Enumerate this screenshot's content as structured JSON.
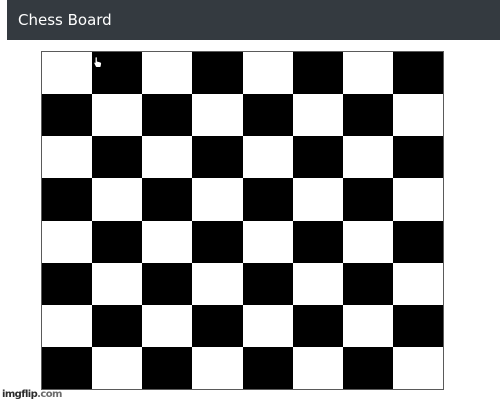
{
  "header": {
    "title": "Chess Board"
  },
  "board": {
    "rows": 8,
    "columns": 8,
    "top_left_color": "light",
    "light_color": "#ffffff",
    "dark_color": "#000000",
    "cursor_square": {
      "row": 0,
      "column": 1
    }
  },
  "cursor": {
    "icon": "hand-pointer-icon"
  },
  "watermark": {
    "text_a": "imgflip",
    "text_b": ".com"
  },
  "colors": {
    "title_bar": "#343a40",
    "title_text": "#ffffff",
    "board_border": "#5a5a5a"
  }
}
